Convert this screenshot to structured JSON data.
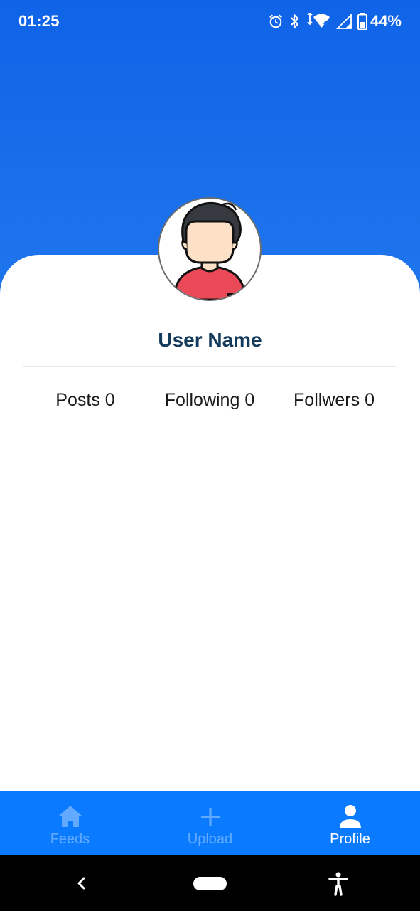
{
  "status_bar": {
    "time": "01:25",
    "battery_percent": "44%",
    "icons": [
      "alarm-icon",
      "bluetooth-icon",
      "wifi-icon",
      "cell-signal-icon",
      "battery-icon"
    ]
  },
  "profile": {
    "avatar_icon": "user-avatar-illustration",
    "user_name": "User Name",
    "stats": [
      {
        "label": "Posts",
        "value": "0"
      },
      {
        "label": "Following",
        "value": "0"
      },
      {
        "label": "Follwers",
        "value": "0"
      }
    ]
  },
  "bottom_nav": {
    "items": [
      {
        "label": "Feeds",
        "icon": "home-icon",
        "active": false
      },
      {
        "label": "Upload",
        "icon": "plus-icon",
        "active": false
      },
      {
        "label": "Profile",
        "icon": "person-icon",
        "active": true
      }
    ]
  },
  "system_nav": {
    "icons": [
      "back-icon",
      "home-pill-icon",
      "accessibility-icon"
    ]
  },
  "colors": {
    "header_gradient_top": "#0f63e7",
    "header_gradient_bottom": "#2076ed",
    "nav_background": "#0a7bff",
    "nav_active": "#ffffff",
    "nav_inactive": "#62aaff",
    "user_name": "#143a5c"
  }
}
